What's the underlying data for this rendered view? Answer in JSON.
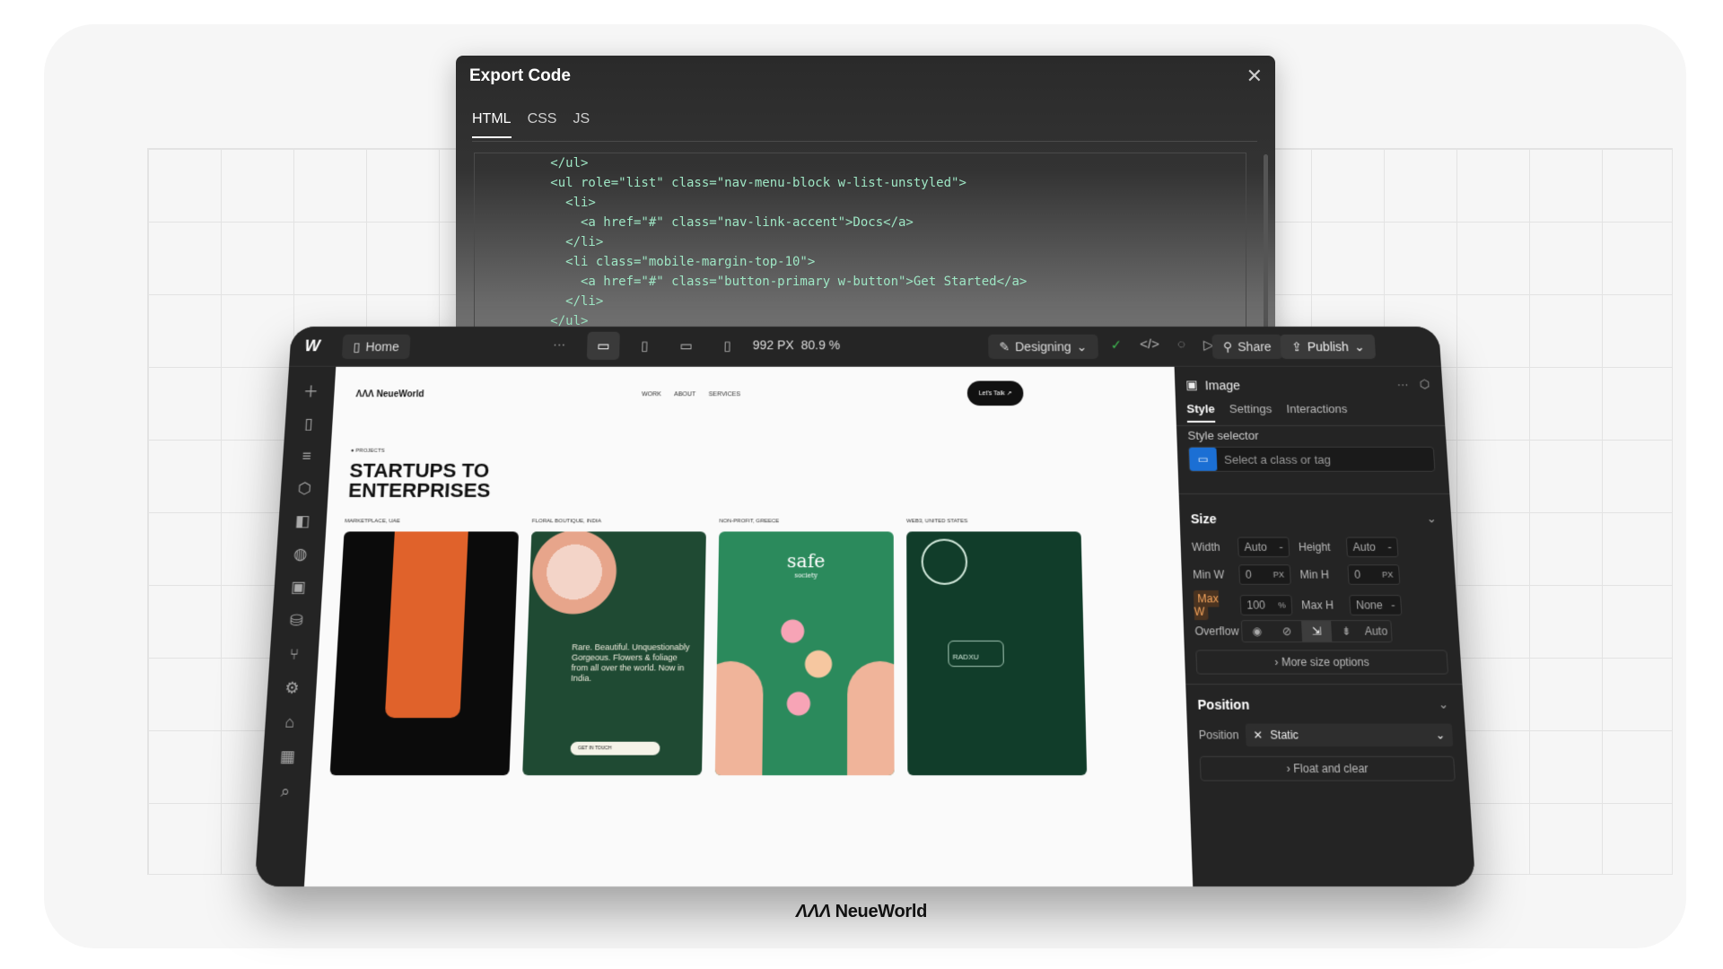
{
  "export": {
    "title": "Export Code",
    "tabs": [
      "HTML",
      "CSS",
      "JS"
    ],
    "active_tab": "HTML",
    "code_lines": [
      "          </ul>",
      "          <ul role=\"list\" class=\"nav-menu-block w-list-unstyled\">",
      "            <li>",
      "              <a href=\"#\" class=\"nav-link-accent\">Docs</a>",
      "            </li>",
      "            <li class=\"mobile-margin-top-10\">",
      "              <a href=\"#\" class=\"button-primary w-button\">Get Started</a>",
      "            </li>",
      "          </ul>"
    ]
  },
  "topbar": {
    "home": "Home",
    "width_value": "992",
    "width_unit": "PX",
    "zoom": "80.9 %",
    "mode": "Designing",
    "share": "Share",
    "publish": "Publish"
  },
  "site": {
    "logo": "NeueWorld",
    "nav": [
      "WORK",
      "ABOUT",
      "SERVICES"
    ],
    "cta": "Let's Talk ↗",
    "section_label": "PROJECTS",
    "headline": "STARTUPS TO ENTERPRISES",
    "cards": [
      {
        "caption": "MARKETPLACE, UAE"
      },
      {
        "caption": "FLORAL BOUTIQUE, INDIA",
        "text": "Rare. Beautiful. Unquestionably Gorgeous. Flowers & foliage from all over the world. Now in India.",
        "button": "GET IN TOUCH"
      },
      {
        "caption": "NON-PROFIT, GREECE",
        "brand": "safe",
        "brand_sub": "society"
      },
      {
        "caption": "WEB3, UNITED STATES",
        "badge": "RADXU"
      }
    ]
  },
  "panel": {
    "element": "Image",
    "tabs": [
      "Style",
      "Settings",
      "Interactions"
    ],
    "style_selector_label": "Style selector",
    "style_selector_placeholder": "Select a class or tag",
    "size": {
      "title": "Size",
      "width_label": "Width",
      "width_value": "Auto",
      "height_label": "Height",
      "height_value": "Auto",
      "minw_label": "Min W",
      "minw_value": "0",
      "minw_unit": "PX",
      "minh_label": "Min H",
      "minh_value": "0",
      "minh_unit": "PX",
      "maxw_label": "Max W",
      "maxw_value": "100",
      "maxw_unit": "%",
      "maxh_label": "Max H",
      "maxh_value": "None",
      "overflow_label": "Overflow",
      "overflow_auto": "Auto",
      "more": "More size options"
    },
    "position": {
      "title": "Position",
      "label": "Position",
      "value": "Static",
      "float": "Float and clear"
    }
  },
  "brand_footer": "NeueWorld"
}
